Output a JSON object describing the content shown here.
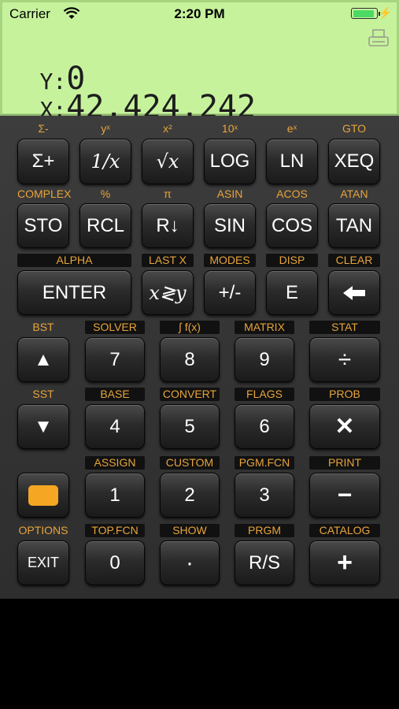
{
  "status_bar": {
    "carrier": "Carrier",
    "time": "2:20 PM"
  },
  "display": {
    "y_label": "Y:",
    "y_value": "0",
    "x_label": "X:",
    "x_value": "42,424,242_"
  },
  "shift_labels": {
    "r1": [
      "Σ-",
      "yˣ",
      "x²",
      "10ˣ",
      "eˣ",
      "GTO"
    ],
    "r2": [
      "COMPLEX",
      "%",
      "π",
      "ASIN",
      "ACOS",
      "ATAN"
    ],
    "r3": [
      "ALPHA",
      "LAST X",
      "MODES",
      "DISP",
      "CLEAR"
    ],
    "r4": [
      "BST",
      "SOLVER",
      "∫ f(x)",
      "MATRIX",
      "STAT"
    ],
    "r5": [
      "SST",
      "BASE",
      "CONVERT",
      "FLAGS",
      "PROB"
    ],
    "r6": [
      "ASSIGN",
      "CUSTOM",
      "PGM.FCN",
      "PRINT"
    ],
    "r7": [
      "OPTIONS",
      "TOP.FCN",
      "SHOW",
      "PRGM",
      "CATALOG"
    ]
  },
  "keys": {
    "r1": [
      "Σ+",
      "1/x",
      "√x",
      "LOG",
      "LN",
      "XEQ"
    ],
    "r2": [
      "STO",
      "RCL",
      "R↓",
      "SIN",
      "COS",
      "TAN"
    ],
    "r3": [
      "ENTER",
      "x≷y",
      "+/-",
      "E",
      "⬅"
    ],
    "r4": [
      "▲",
      "7",
      "8",
      "9",
      "÷"
    ],
    "r5": [
      "▼",
      "4",
      "5",
      "6",
      "✕"
    ],
    "r6": [
      "",
      "1",
      "2",
      "3",
      "−"
    ],
    "r7": [
      "EXIT",
      "0",
      "·",
      "R/S",
      "+"
    ]
  },
  "colors": {
    "lcd": "#c6f29c",
    "shift_label": "#e8a43a",
    "shift_key": "#f5a623"
  }
}
